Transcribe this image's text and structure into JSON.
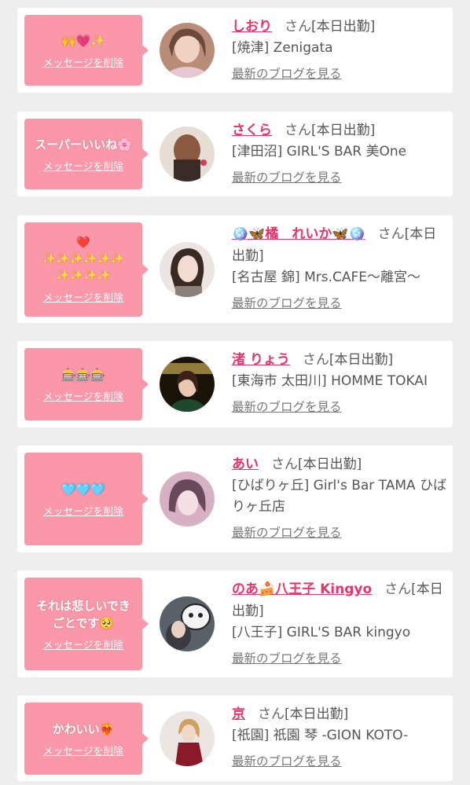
{
  "delete_label": "メッセージを削除",
  "blog_label": "最新のブログを見る",
  "san_label": "さん",
  "cards": [
    {
      "stamp": "🙌💗✨",
      "name": "しおり",
      "status": "[本日出勤]",
      "shop": "[焼津] Zenigata",
      "avatar_color": "#c8a088"
    },
    {
      "stamp": "スーパーいいね🌸",
      "name": "さくら",
      "status": "[本日出勤]",
      "shop": "[津田沼] GIRL'S BAR 美One",
      "avatar_color": "#a07a5e"
    },
    {
      "stamp": "❤️\n✨✨✨✨✨✨\n✨✨✨✨",
      "name": "🪩🦋橘　れいか🦋🪩",
      "status": "[本日出勤]",
      "shop": "[名古屋 錦] Mrs.CAFE〜離宮〜",
      "avatar_color": "#d9c8c0"
    },
    {
      "stamp": "🎰🎰🎰",
      "name": "渚 りょう",
      "status": "[本日出勤]",
      "shop": "[東海市 太田川] HOMME TOKAI",
      "avatar_color": "#5a4a20"
    },
    {
      "stamp": "🩵🩵🩵",
      "name": "あい",
      "status": "[本日出勤]",
      "shop": "[ひばりヶ丘] Girl's Bar TAMA ひばりヶ丘店",
      "avatar_color": "#c9a6b6"
    },
    {
      "stamp": "それは悲しいできごとです🥺",
      "name": "のあ🍰八王子 Kingyo",
      "status": "[本日出勤]",
      "shop": "[八王子] GIRL'S BAR kingyo",
      "avatar_color": "#7a7f88"
    },
    {
      "stamp": "かわいい❤️‍🔥",
      "name": "京",
      "status": "[本日出勤]",
      "shop": "[祇園] 祇園 琴 -GION KOTO-",
      "avatar_color": "#c9b3a8"
    }
  ]
}
